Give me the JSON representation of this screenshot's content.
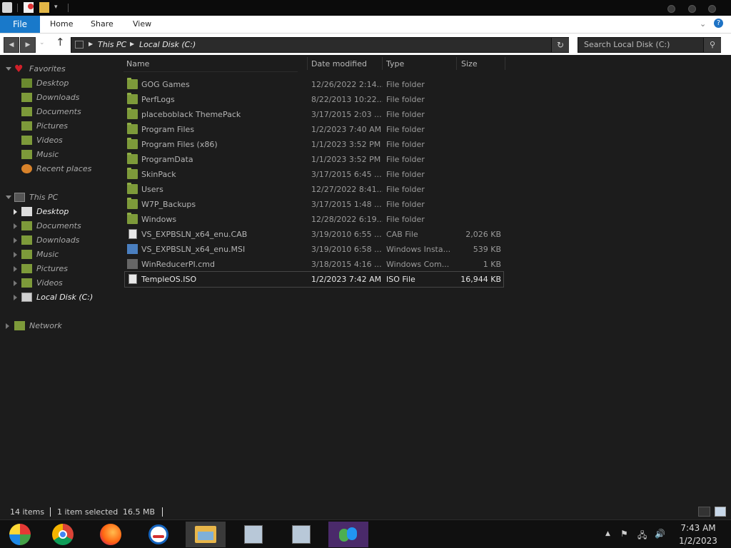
{
  "ribbon": {
    "file_tab": "File",
    "tabs": [
      "Home",
      "Share",
      "View"
    ],
    "help_icon": "?"
  },
  "address": {
    "crumbs": [
      "This PC",
      "Local Disk (C:)"
    ],
    "search_placeholder": "Search Local Disk (C:)"
  },
  "navpane": {
    "favorites": {
      "label": "Favorites",
      "items": [
        "Desktop",
        "Downloads",
        "Documents",
        "Pictures",
        "Videos",
        "Music",
        "Recent places"
      ]
    },
    "this_pc": {
      "label": "This PC",
      "items": [
        "Desktop",
        "Documents",
        "Downloads",
        "Music",
        "Pictures",
        "Videos",
        "Local Disk (C:)"
      ]
    },
    "network": {
      "label": "Network"
    }
  },
  "columns": {
    "name": "Name",
    "date": "Date modified",
    "type": "Type",
    "size": "Size"
  },
  "files": [
    {
      "name": "GOG Games",
      "date": "12/26/2022 2:14...",
      "type": "File folder",
      "size": "",
      "kind": "folder"
    },
    {
      "name": "PerfLogs",
      "date": "8/22/2013 10:22...",
      "type": "File folder",
      "size": "",
      "kind": "folder"
    },
    {
      "name": "placeboblack ThemePack",
      "date": "3/17/2015 2:03 ...",
      "type": "File folder",
      "size": "",
      "kind": "folder"
    },
    {
      "name": "Program Files",
      "date": "1/2/2023 7:40 AM",
      "type": "File folder",
      "size": "",
      "kind": "folder"
    },
    {
      "name": "Program Files (x86)",
      "date": "1/1/2023 3:52 PM",
      "type": "File folder",
      "size": "",
      "kind": "folder"
    },
    {
      "name": "ProgramData",
      "date": "1/1/2023 3:52 PM",
      "type": "File folder",
      "size": "",
      "kind": "folder"
    },
    {
      "name": "SkinPack",
      "date": "3/17/2015 6:45 ...",
      "type": "File folder",
      "size": "",
      "kind": "folder"
    },
    {
      "name": "Users",
      "date": "12/27/2022 8:41...",
      "type": "File folder",
      "size": "",
      "kind": "folder"
    },
    {
      "name": "W7P_Backups",
      "date": "3/17/2015 1:48 ...",
      "type": "File folder",
      "size": "",
      "kind": "folder"
    },
    {
      "name": "Windows",
      "date": "12/28/2022 6:19...",
      "type": "File folder",
      "size": "",
      "kind": "folder"
    },
    {
      "name": "VS_EXPBSLN_x64_enu.CAB",
      "date": "3/19/2010 6:55 ...",
      "type": "CAB File",
      "size": "2,026 KB",
      "kind": "file"
    },
    {
      "name": "VS_EXPBSLN_x64_enu.MSI",
      "date": "3/19/2010 6:58 ...",
      "type": "Windows Insta...",
      "size": "539 KB",
      "kind": "installer"
    },
    {
      "name": "WinReducerPI.cmd",
      "date": "3/18/2015 4:16 ...",
      "type": "Windows Com...",
      "size": "1 KB",
      "kind": "cmd"
    },
    {
      "name": "TempleOS.ISO",
      "date": "1/2/2023 7:42 AM",
      "type": "ISO File",
      "size": "16,944 KB",
      "kind": "file",
      "selected": true
    }
  ],
  "status": {
    "items_count": "14 items",
    "selection": "1 item selected",
    "selection_size": "16.5 MB"
  },
  "taskbar": {
    "apps": [
      "start-orb",
      "chrome",
      "firefox",
      "obama-logo-app",
      "file-explorer",
      "installer-1",
      "installer-2",
      "messenger"
    ],
    "clock_time": "7:43 AM",
    "clock_date": "1/2/2023"
  },
  "colors": {
    "accent": "#1979ca",
    "window_bg": "#1c1c1c",
    "folder": "#7d9a3a",
    "favorites_heart": "#d0202a"
  }
}
